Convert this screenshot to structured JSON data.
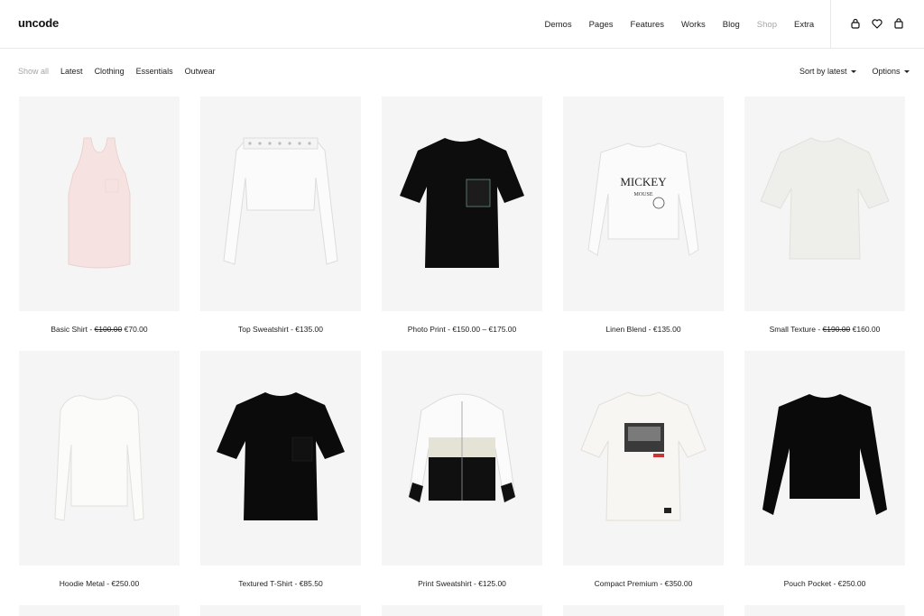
{
  "brand": {
    "logo_text": "uncode"
  },
  "nav": {
    "items": [
      {
        "label": "Demos",
        "muted": false
      },
      {
        "label": "Pages",
        "muted": false
      },
      {
        "label": "Features",
        "muted": false
      },
      {
        "label": "Works",
        "muted": false
      },
      {
        "label": "Blog",
        "muted": false
      },
      {
        "label": "Shop",
        "muted": true
      },
      {
        "label": "Extra",
        "muted": false
      }
    ]
  },
  "header_icons": [
    "user-icon",
    "heart-icon",
    "shopping-bag-icon"
  ],
  "filters": {
    "items": [
      "Show all",
      "Latest",
      "Clothing",
      "Essentials",
      "Outwear"
    ],
    "active": "Show all"
  },
  "sort": {
    "sort_label": "Sort by latest",
    "options_label": "Options"
  },
  "products": [
    {
      "name": "Basic Shirt",
      "old_price": "€100.00",
      "price": "€70.00",
      "image": "pink-tank-top"
    },
    {
      "name": "Top Sweatshirt",
      "old_price": "",
      "price": "€135.00",
      "image": "white-cropped-sweatshirt"
    },
    {
      "name": "Photo Print",
      "old_price": "",
      "price": "€150.00 – €175.00",
      "image": "black-pocket-tshirt"
    },
    {
      "name": "Linen Blend",
      "old_price": "",
      "price": "€135.00",
      "image": "white-mickey-sweatshirt"
    },
    {
      "name": "Small Texture",
      "old_price": "€190.00",
      "price": "€160.00",
      "image": "cream-raglan-tshirt"
    },
    {
      "name": "Hoodie Metal",
      "old_price": "",
      "price": "€250.00",
      "image": "white-puff-sleeve-top"
    },
    {
      "name": "Textured T-Shirt",
      "old_price": "",
      "price": "€85.50",
      "image": "black-tshirt"
    },
    {
      "name": "Print Sweatshirt",
      "old_price": "",
      "price": "€125.00",
      "image": "colorblock-hoodie"
    },
    {
      "name": "Compact Premium",
      "old_price": "",
      "price": "€350.00",
      "image": "white-photo-print-tshirt"
    },
    {
      "name": "Pouch Pocket",
      "old_price": "",
      "price": "€250.00",
      "image": "black-sweatshirt"
    }
  ],
  "colors": {
    "text": "#222222",
    "muted": "#a6a6a6",
    "tile": "#f5f5f5",
    "border": "#e8e8e8"
  }
}
